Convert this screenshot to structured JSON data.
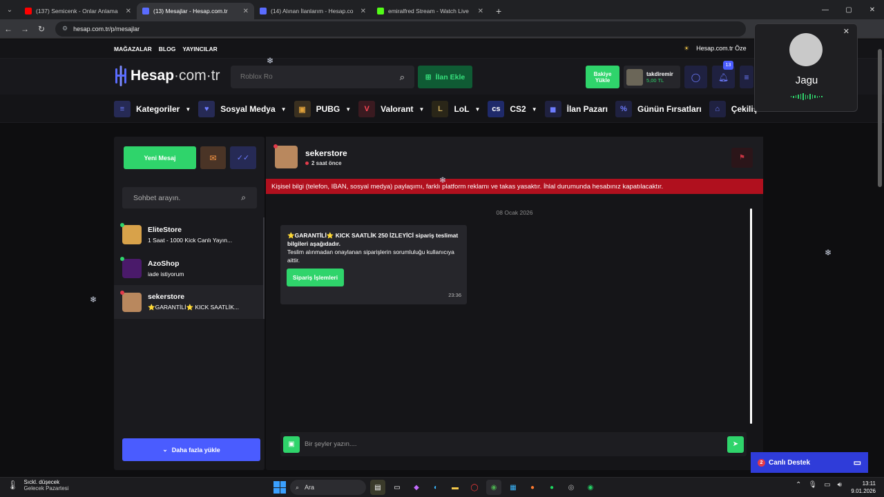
{
  "browser": {
    "tabs": [
      {
        "title": "(137) Semicenk - Onlar Anlama",
        "active": false,
        "color": "#ff0000"
      },
      {
        "title": "(13) Mesajlar - Hesap.com.tr",
        "active": true,
        "color": "#5a6cff"
      },
      {
        "title": "(14) Alınan İlanlarım - Hesap.co",
        "active": false,
        "color": "#5a6cff"
      },
      {
        "title": "emiralfred Stream - Watch Live",
        "active": false,
        "color": "#53fc18"
      }
    ],
    "url": "hesap.com.tr/p/mesajlar"
  },
  "site": {
    "toplinks": [
      "MAĞAZALAR",
      "BLOG",
      "YAYINCILAR"
    ],
    "topright": "Hesap.com.tr Öze",
    "logo": {
      "main": "Hesap",
      "dot": "·",
      "rest": "com·tr"
    },
    "search_placeholder": "Roblox Ro",
    "ilan_ekle": "İlan Ekle",
    "bakiye": "Bakiye Yükle",
    "user": {
      "name": "takdiremir",
      "balance": "5,00 TL"
    },
    "notif_count": "13",
    "categories": [
      {
        "label": "Kategoriler",
        "icon": "≡",
        "bg": "#262a55",
        "fg": "#6d7cff",
        "caret": true
      },
      {
        "label": "Sosyal Medya",
        "icon": "♥",
        "bg": "#262a55",
        "fg": "#6d7cff",
        "caret": true
      },
      {
        "label": "PUBG",
        "icon": "▣",
        "bg": "#3a3020",
        "fg": "#e0a23a",
        "caret": true
      },
      {
        "label": "Valorant",
        "icon": "V",
        "bg": "#3a1a20",
        "fg": "#ff4655",
        "caret": true
      },
      {
        "label": "LoL",
        "icon": "L",
        "bg": "#2a2618",
        "fg": "#c8a85a",
        "caret": true
      },
      {
        "label": "CS2",
        "icon": "cs",
        "bg": "#1f2a6a",
        "fg": "#ffffff",
        "caret": true
      },
      {
        "label": "İlan Pazarı",
        "icon": "◼",
        "bg": "#1f2140",
        "fg": "#6d7cff",
        "caret": false
      },
      {
        "label": "Günün Fırsatları",
        "icon": "%",
        "bg": "#1f2140",
        "fg": "#6d7cff",
        "caret": false
      },
      {
        "label": "Çekilişler",
        "icon": "⌂",
        "bg": "#1f2140",
        "fg": "#6d7cff",
        "caret": false
      }
    ]
  },
  "messages": {
    "new_message": "Yeni Mesaj",
    "search_placeholder": "Sohbet arayın.",
    "conversations": [
      {
        "name": "EliteStore",
        "preview": "1 Saat - 1000 Kick Canlı Yayın...",
        "status_color": "#2fd46b",
        "avatar_color": "#d8a24a",
        "selected": false
      },
      {
        "name": "AzoShop",
        "preview": "iade istiyorum",
        "status_color": "#2fd46b",
        "avatar_color": "#4a1a6a",
        "selected": false
      },
      {
        "name": "sekerstore",
        "preview": "⭐GARANTİLİ⭐ KICK SAATLİK...",
        "status_color": "#e33b4b",
        "avatar_color": "#b9885e",
        "selected": true
      }
    ],
    "load_more": "Daha fazla yükle",
    "chat": {
      "name": "sekerstore",
      "last_seen": "2 saat önce",
      "warning": "Kişisel bilgi (telefon, IBAN, sosyal medya) paylaşımı, farklı platform reklamı ve takas yasaktır. İhlal durumunda hesabınız kapatılacaktır.",
      "date": "08 Ocak 2026",
      "message_title": "⭐GARANTİLİ⭐ KICK SAATLİK 250 İZLEYİCİ sipariş teslimat bilgileri aşağıdadır.",
      "message_body": "Teslim alınmadan onaylanan siparişlerin sorumluluğu kullanıcıya aittir.",
      "order_button": "Sipariş İşlemleri",
      "message_time": "23:36",
      "composer_placeholder": "Bir şeyler yazın...."
    }
  },
  "support": {
    "label": "Canlı Destek",
    "count": "2"
  },
  "popup": {
    "name": "Jagu"
  },
  "taskbar": {
    "weather_line1": "Sıckl. düşecek",
    "weather_line2": "Gelecek Pazartesi",
    "search": "Ara",
    "time": "13:11",
    "date": "9.01.2026"
  },
  "colors": {
    "accent_green": "#2fd46b",
    "accent_blue": "#4a5cff",
    "danger": "#b0101e"
  }
}
